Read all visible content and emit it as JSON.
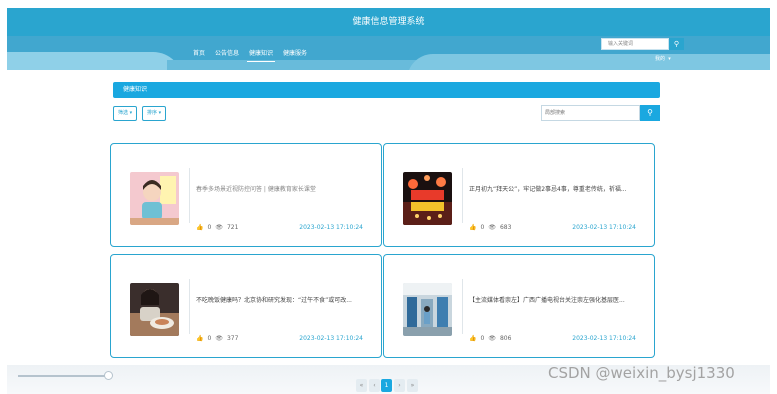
{
  "app": {
    "title": "健康信息管理系统"
  },
  "nav": {
    "items": [
      "首页",
      "公告信息",
      "健康知识",
      "健康服务"
    ],
    "active_index": 2
  },
  "top_search": {
    "placeholder": "输入关键词",
    "button_icon": "search-icon"
  },
  "user_menu": {
    "label": "我的",
    "icon": "caret-down-icon"
  },
  "section": {
    "title": "健康知识"
  },
  "toolbar": {
    "filter_label": "筛选 ▾",
    "sort_label": "排序 ▾",
    "local_search_placeholder": "局部搜索"
  },
  "cards": [
    {
      "title": "春季多场景近视防控问答 | 健康教育家长课堂",
      "likes": "0",
      "views": "721",
      "date": "2023-02-13 17:10:24"
    },
    {
      "title": "正月初九“拜天公”，牢记做2事忌4事，尊重老传统，祈福...",
      "likes": "0",
      "views": "683",
      "date": "2023-02-13 17:10:24"
    },
    {
      "title": "不吃晚饭健康吗？北京协和研究发现：“过午不食”或可改...",
      "likes": "0",
      "views": "377",
      "date": "2023-02-13 17:10:24"
    },
    {
      "title": "【主流媒体看崇左】广西广播电视台关注崇左强化基层医...",
      "likes": "0",
      "views": "806",
      "date": "2023-02-13 17:10:24"
    }
  ],
  "pagination": {
    "prev": "«",
    "prev2": "‹",
    "current": "1",
    "next": "›",
    "next2": "»"
  },
  "watermark": "CSDN @weixin_bysj1330",
  "colors": {
    "primary": "#2aa5cf",
    "accent": "#1aa8e0"
  }
}
